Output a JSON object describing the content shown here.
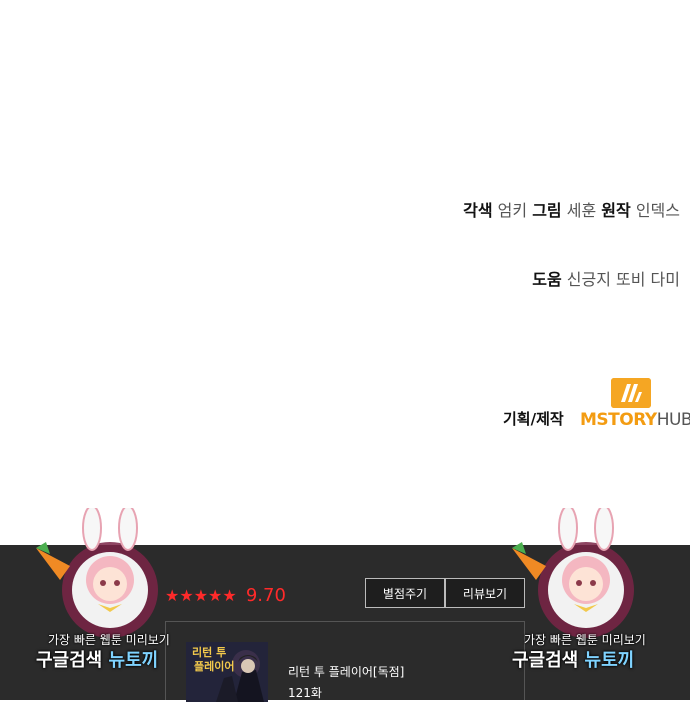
{
  "credits": {
    "line1": [
      {
        "role": "각색",
        "name": "엄키"
      },
      {
        "role": "그림",
        "name": "세훈"
      },
      {
        "role": "원작",
        "name": "인덱스"
      }
    ],
    "line2": {
      "role": "도움",
      "name": "신긍지 또비 다미"
    },
    "produce_label": "기획/제작",
    "logo": {
      "part1": "MSTORY",
      "part2": "HUB",
      "accent": "#f39c12"
    }
  },
  "rating": {
    "stars": "★★★★★",
    "score": "9.70",
    "color": "#ff2a2a"
  },
  "buttons": {
    "rate": "별점주기",
    "review": "리뷰보기"
  },
  "series": {
    "title": "리턴 투 플레이어[독점]",
    "episode": "121화",
    "thumb_title_line1": "리턴 투",
    "thumb_title_line2": "플레이어"
  },
  "watermark": {
    "line1": "가장 빠른 웹툰 미리보기",
    "line2_prefix": "구글검색 ",
    "line2_highlight": "뉴토끼"
  }
}
